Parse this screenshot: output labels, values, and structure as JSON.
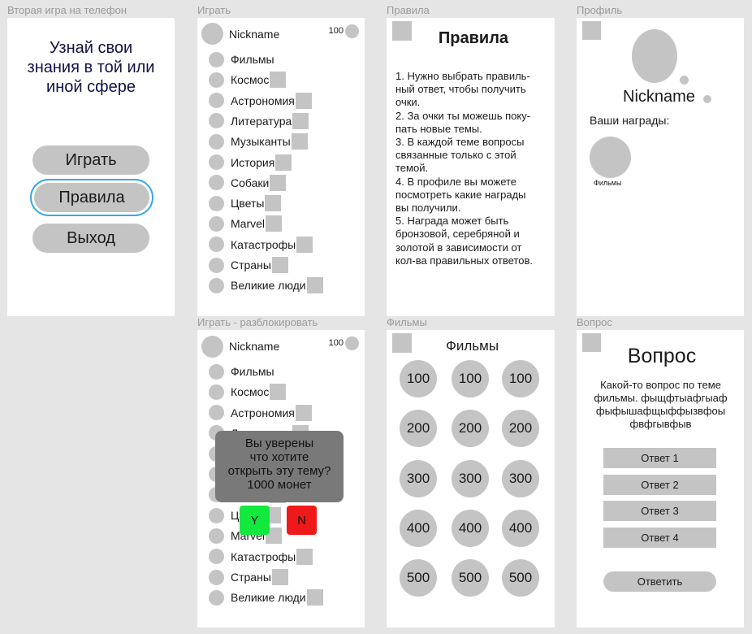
{
  "frames": {
    "home": "Вторая игра на телефон",
    "play": "Играть",
    "rules": "Правила",
    "profile": "Профиль",
    "unlock": "Играть - разблокировать",
    "films": "Фильмы",
    "question": "Вопрос"
  },
  "home": {
    "headline_lines": [
      "Узнай свои",
      "знания в той или",
      "иной сфере"
    ],
    "play_button": "Играть",
    "rules_button": "Правила",
    "exit_button": "Выход"
  },
  "player": {
    "nickname": "Nickname",
    "coins": "100"
  },
  "topics": [
    {
      "label": "Фильмы",
      "locked": false
    },
    {
      "label": "Космос",
      "locked": true
    },
    {
      "label": "Астрономия",
      "locked": true
    },
    {
      "label": "Литература",
      "locked": true
    },
    {
      "label": "Музыканты",
      "locked": true
    },
    {
      "label": "История",
      "locked": true
    },
    {
      "label": "Собаки",
      "locked": true
    },
    {
      "label": "Цветы",
      "locked": true
    },
    {
      "label": "Marvel",
      "locked": true
    },
    {
      "label": "Катастрофы",
      "locked": true
    },
    {
      "label": "Страны",
      "locked": true
    },
    {
      "label": "Великие люди",
      "locked": true
    }
  ],
  "rules": {
    "title": "Правила",
    "lines": [
      "1. Нужно выбрать правиль-",
      "ный ответ, чтобы получить",
      "очки.",
      "2. За очки ты можешь поку-",
      "пать новые темы.",
      "3. В каждой теме вопросы",
      "связанные только с этой",
      "темой.",
      "4. В профиле вы можете",
      "посмотреть какие награды",
      "вы получили.",
      "5. Награда может быть",
      "бронзовой, серебряной и",
      "золотой в зависимости от",
      "кол-ва правильных ответов."
    ]
  },
  "profile": {
    "nickname": "Nickname",
    "awards_label": "Ваши награды:",
    "award_name": "Фильмы"
  },
  "unlock": {
    "dialog_lines": [
      "Вы уверены",
      "что хотите",
      "открыть эту тему?",
      "1000 монет"
    ],
    "yes_label": "Y",
    "no_label": "N",
    "yes_color": "#13e83f",
    "no_color": "#f01919"
  },
  "films": {
    "title": "Фильмы",
    "prices": [
      "100",
      "200",
      "300",
      "400",
      "500"
    ]
  },
  "question": {
    "title": "Вопрос",
    "text_lines": [
      "Какой-то вопрос по теме",
      "фильмы. фыщфтыафгыаф",
      "фыфышафщыффызвфоы",
      "фвфгывфыв"
    ],
    "answers": [
      "Ответ 1",
      "Ответ 2",
      "Ответ 3",
      "Ответ 4"
    ],
    "submit_label": "Ответить"
  },
  "colors": {
    "selection": "#35a8e8",
    "headline": "#111144",
    "placeholder": "#c4c4c4"
  }
}
